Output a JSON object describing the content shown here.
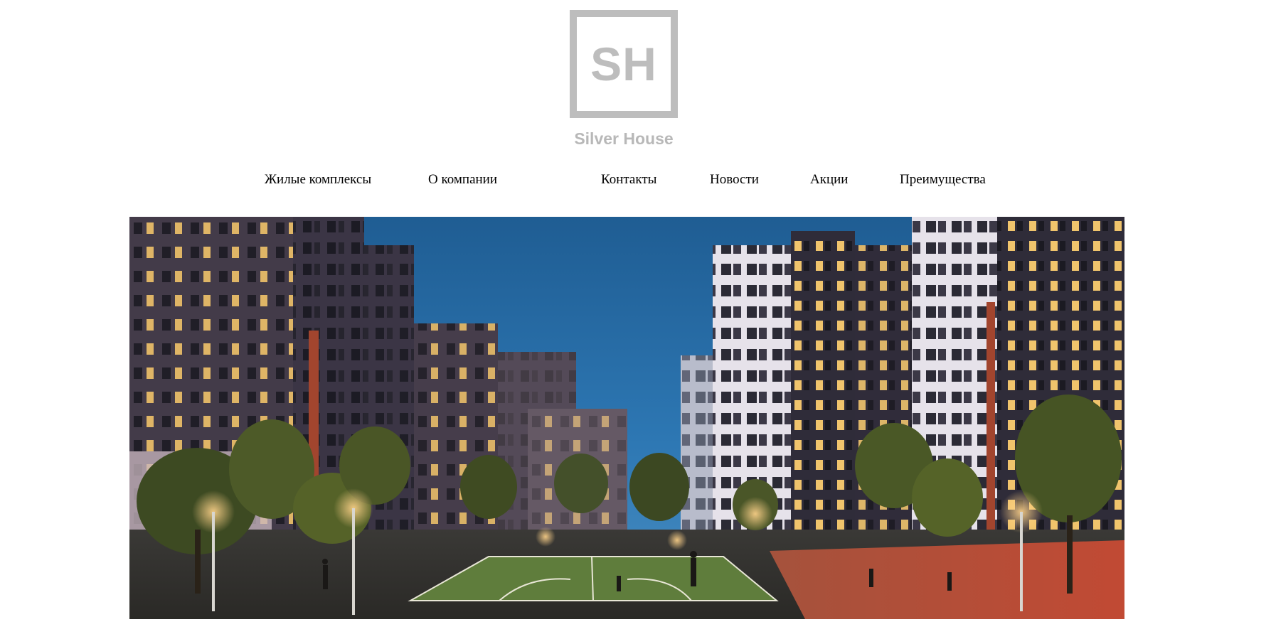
{
  "logo": {
    "mark": "SH",
    "name": "Silver House",
    "color": "#bdbdbd"
  },
  "nav": {
    "items": [
      {
        "label": "Жилые комплексы"
      },
      {
        "label": "О компании"
      },
      {
        "label": "Контакты"
      },
      {
        "label": "Новости"
      },
      {
        "label": "Акции"
      },
      {
        "label": "Преимущества"
      }
    ]
  },
  "hero": {
    "subject": "night-courtyard-residential-complex"
  }
}
